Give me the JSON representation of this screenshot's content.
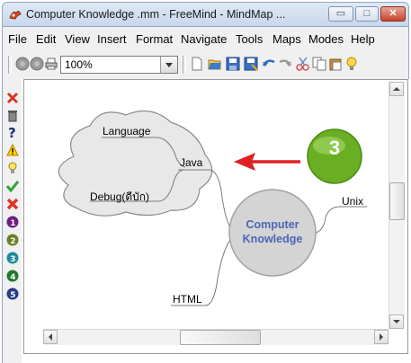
{
  "window": {
    "title": "Computer Knowledge .mm - FreeMind - MindMap ...",
    "min_glyph": "▭",
    "max_glyph": "□",
    "close_glyph": "✕"
  },
  "menu": [
    "File",
    "Edit",
    "View",
    "Insert",
    "Format",
    "Navigate",
    "Tools",
    "Maps",
    "Modes",
    "Help"
  ],
  "toolbar": {
    "zoom_value": "100%",
    "icons": [
      "back-icon",
      "forward-icon",
      "print-icon",
      "new-map-icon",
      "open-icon",
      "save-icon",
      "save-as-icon",
      "undo-icon",
      "redo-icon",
      "cut-icon",
      "copy-icon",
      "paste-icon",
      "idea-icon"
    ]
  },
  "sidebar_icons": [
    "remove-icon",
    "trash-icon",
    "question-icon",
    "warning-icon",
    "lightbulb-icon",
    "checkmark-icon",
    "cross-icon",
    "priority-1-icon",
    "priority-2-icon",
    "priority-3-icon",
    "priority-4-icon",
    "priority-5-icon"
  ],
  "mindmap": {
    "root": {
      "line1": "Computer",
      "line2": "Knowledge"
    },
    "nodes": {
      "language": "Language",
      "java": "Java",
      "debug": "Debug(ดีบัก)",
      "html": "HTML",
      "unix": "Unix"
    },
    "callout_number": "3",
    "colors": {
      "root_text": "#4a66b6",
      "arrow": "#e02020",
      "badge": "#6aae23"
    }
  }
}
